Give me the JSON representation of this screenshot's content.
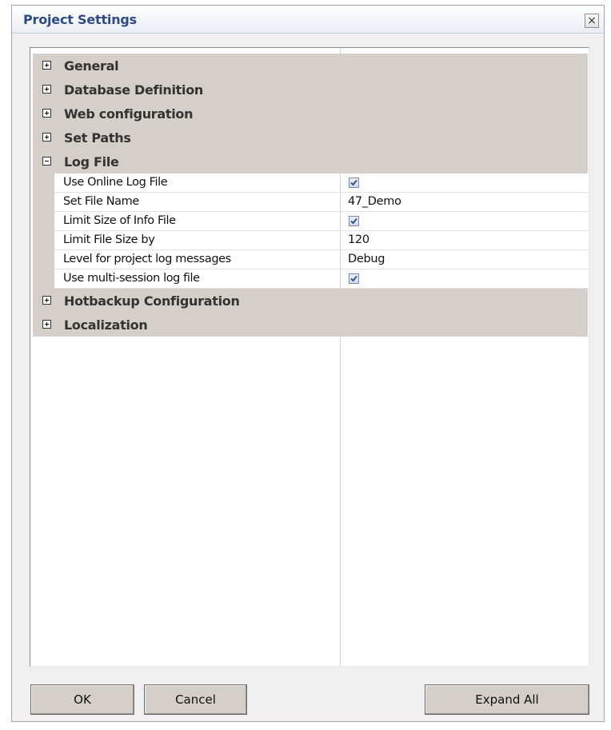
{
  "window": {
    "title": "Project Settings",
    "close_label": "×"
  },
  "property_grid": {
    "categories_top": [
      {
        "label": "General",
        "state": "collapsed"
      },
      {
        "label": "Database Definition",
        "state": "collapsed"
      },
      {
        "label": "Web configuration",
        "state": "collapsed"
      },
      {
        "label": "Set Paths",
        "state": "collapsed"
      },
      {
        "label": "Log File",
        "state": "expanded"
      }
    ],
    "log_file_properties": [
      {
        "name": "Use Online Log File",
        "type": "checkbox",
        "checked": true
      },
      {
        "name": "Set File Name",
        "type": "text",
        "value": "47_Demo"
      },
      {
        "name": "Limit Size of Info File",
        "type": "checkbox",
        "checked": true
      },
      {
        "name": "Limit File Size by",
        "type": "text",
        "value": "120"
      },
      {
        "name": "Level for project log messages",
        "type": "text",
        "value": "Debug"
      },
      {
        "name": "Use multi-session log file",
        "type": "checkbox",
        "checked": true
      }
    ],
    "categories_bottom": [
      {
        "label": "Hotbackup Configuration",
        "state": "collapsed"
      },
      {
        "label": "Localization",
        "state": "collapsed"
      }
    ]
  },
  "buttons": {
    "ok": "OK",
    "cancel": "Cancel",
    "expand_all": "Expand All"
  },
  "colors": {
    "title_text": "#2b4a86",
    "category_background": "#d4cfc8",
    "button_background": "#d4cfc8"
  }
}
